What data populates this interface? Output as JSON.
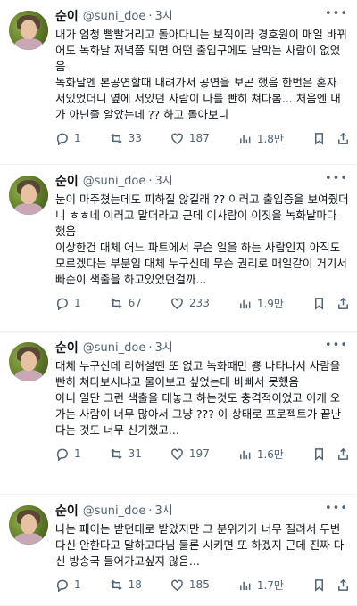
{
  "tweets": [
    {
      "name": "순이",
      "handle": "@suni_doe",
      "time": "3시",
      "text": "내가 엄청 빨빨거리고 돌아다니는 보직이라 경호원이 매일 바뀌어도 녹화날 저녁쯤 되면 어떤 출입구에도 날막는 사람이 없었음\n녹화날엔 본공연할때 내려가서 공연을 보곤 했음 한번은 혼자 서있었더니 옆에 서있던 사람이 나를 빤히 쳐다봄... 처음엔 내가 아닌줄 알았는데 ?? 하고 돌아보니",
      "replies": "1",
      "retweets": "33",
      "likes": "187",
      "views": "1.8만"
    },
    {
      "name": "순이",
      "handle": "@suni_doe",
      "time": "3시",
      "text": "눈이 마주쳤는데도 피하질 않길래 ?? 이러고 출입증을 보여줬더니 ㅎㅎ네 이러고 말더라고 근데 이사람이 이짓을 녹화날마다 했음\n이상한건 대체 어느 파트에서 무슨 일을 하는 사람인지 아직도 모르겠다는 부분임 대체 누구신데 무슨 권리로 매일같이 거기서 빠순이 색출을 하고있었던걸까...",
      "replies": "1",
      "retweets": "67",
      "likes": "233",
      "views": "1.9만"
    },
    {
      "name": "순이",
      "handle": "@suni_doe",
      "time": "3시",
      "text": "대체 누구신데 리허설땐 또 없고 녹화때만 뿅 나타나서 사람을 빤히 쳐다보시냐고 물어보고 싶었는데 바빠서 못했음\n아니 일단 그런 색출을 대놓고 하는것도 충격적이었고 이게 오가는 사람이 너무 많아서 그냥 ??? 이 상태로 프로젝트가 끝난다는 것도 너무 신기했고...",
      "replies": "1",
      "retweets": "31",
      "likes": "197",
      "views": "1.6만"
    },
    {
      "name": "순이",
      "handle": "@suni_doe",
      "time": "3시",
      "text": "나는 페이는 받던대로 받았지만 그 분위기가 너무 질려서 두번다신 안한다고 말하고다님 물론 시키면 또 하겠지 근데 진짜 다신 방송국 들어가고싶지 않음...",
      "replies": "1",
      "retweets": "18",
      "likes": "185",
      "views": "1.7만"
    }
  ]
}
